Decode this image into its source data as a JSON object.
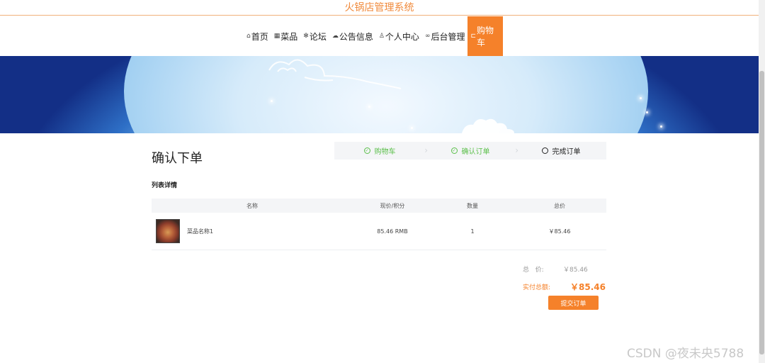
{
  "site": {
    "title": "火锅店管理系统"
  },
  "nav": {
    "items": [
      {
        "icon": "home-icon",
        "glyph": "⌂",
        "label": "首页"
      },
      {
        "icon": "dish-icon",
        "glyph": "▦",
        "label": "菜品"
      },
      {
        "icon": "forum-icon",
        "glyph": "✻",
        "label": "论坛"
      },
      {
        "icon": "notice-icon",
        "glyph": "☁",
        "label": "公告信息"
      },
      {
        "icon": "user-icon",
        "glyph": "♙",
        "label": "个人中心"
      },
      {
        "icon": "link-icon",
        "glyph": "∞",
        "label": "后台管理"
      },
      {
        "icon": "cart-icon",
        "glyph": "⊏",
        "label": "购物车"
      }
    ],
    "active_index": 6,
    "accent": "#f5812a"
  },
  "page": {
    "heading": "确认下单",
    "section_label": "列表详情"
  },
  "steps": [
    {
      "label": "购物车",
      "state": "done"
    },
    {
      "label": "确认订单",
      "state": "done"
    },
    {
      "label": "完成订单",
      "state": "current"
    }
  ],
  "table": {
    "headers": {
      "name": "名称",
      "price": "现价/积分",
      "qty": "数量",
      "total": "总价"
    },
    "rows": [
      {
        "name": "菜品名称1",
        "price": "85.46 RMB",
        "qty": "1",
        "total": "￥85.46"
      }
    ]
  },
  "summary": {
    "total_label": "总   价:",
    "total_value": "￥85.46",
    "pay_label": "实付总额:",
    "pay_value": "￥85.46"
  },
  "actions": {
    "submit_label": "提交订单"
  },
  "watermark": "CSDN @夜未央5788"
}
